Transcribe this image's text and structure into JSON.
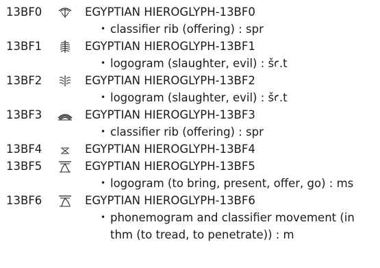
{
  "entries": [
    {
      "code": "13BF0",
      "glyph_icon": "rib-offering-hieroglyph-icon",
      "name": "EGYPTIAN HIEROGLYPH-13BF0",
      "notes": [
        "classifier rib (offering) : spr"
      ]
    },
    {
      "code": "13BF1",
      "glyph_icon": "slaughter-hieroglyph-icon",
      "name": "EGYPTIAN HIEROGLYPH-13BF1",
      "notes": [
        "logogram (slaughter, evil) : šꜥ.t"
      ]
    },
    {
      "code": "13BF2",
      "glyph_icon": "slaughter-variant-hieroglyph-icon",
      "name": "EGYPTIAN HIEROGLYPH-13BF2",
      "notes": [
        "logogram (slaughter, evil) : šꜥ.t"
      ]
    },
    {
      "code": "13BF3",
      "glyph_icon": "rib-flat-hieroglyph-icon",
      "name": "EGYPTIAN HIEROGLYPH-13BF3",
      "notes": [
        "classifier rib (offering) : spr"
      ]
    },
    {
      "code": "13BF4",
      "glyph_icon": "small-crossed-hieroglyph-icon",
      "name": "EGYPTIAN HIEROGLYPH-13BF4",
      "notes": []
    },
    {
      "code": "13BF5",
      "glyph_icon": "walking-legs-table-hieroglyph-icon",
      "name": "EGYPTIAN HIEROGLYPH-13BF5",
      "notes": [
        "logogram (to bring, present, offer, go) : ms"
      ]
    },
    {
      "code": "13BF6",
      "glyph_icon": "walking-legs-table-variant-hieroglyph-icon",
      "name": "EGYPTIAN HIEROGLYPH-13BF6",
      "notes": [
        "phonemogram and classifier movement (in thm (to tread, to penetrate)) : m"
      ]
    }
  ]
}
